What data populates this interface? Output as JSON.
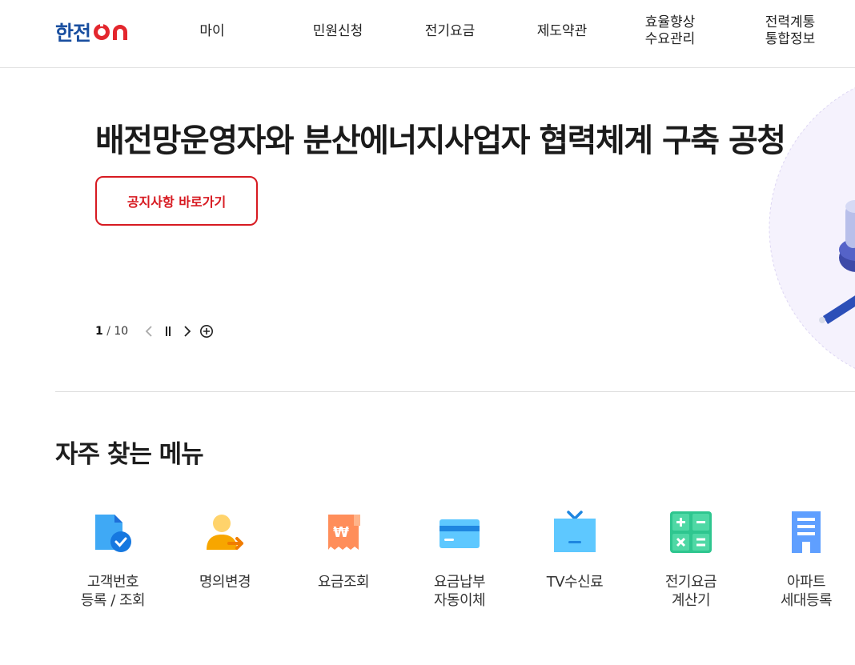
{
  "header": {
    "logo_text": "한전",
    "logo_on": "ON",
    "nav": [
      {
        "label": "마이"
      },
      {
        "label": "민원신청"
      },
      {
        "label": "전기요금"
      },
      {
        "label": "제도약관"
      },
      {
        "label": "효율향상\n수요관리"
      },
      {
        "label": "전력계통\n통합정보"
      }
    ]
  },
  "hero": {
    "title": "배전망운영자와 분산에너지사업자 협력체계 구축 공청",
    "button_label": "공지사항 바로가기",
    "pager": {
      "current": "1",
      "separator": "/",
      "total": "10"
    },
    "controls": [
      "chevron-left-icon",
      "pause-icon",
      "chevron-right-icon",
      "plus-circle-icon"
    ]
  },
  "frequent": {
    "title": "자주 찾는 메뉴",
    "items": [
      {
        "label": "고객번호\n등록 / 조회",
        "icon": "document-check-icon"
      },
      {
        "label": "명의변경",
        "icon": "user-transfer-icon"
      },
      {
        "label": "요금조회",
        "icon": "won-receipt-icon"
      },
      {
        "label": "요금납부\n자동이체",
        "icon": "credit-card-icon"
      },
      {
        "label": "TV수신료",
        "icon": "tv-icon"
      },
      {
        "label": "전기요금\n계산기",
        "icon": "calculator-icon"
      },
      {
        "label": "아파트\n세대등록",
        "icon": "apartment-icon"
      }
    ]
  },
  "colors": {
    "brand_blue": "#1a4fa0",
    "brand_red": "#d71a21",
    "text": "#222222"
  }
}
